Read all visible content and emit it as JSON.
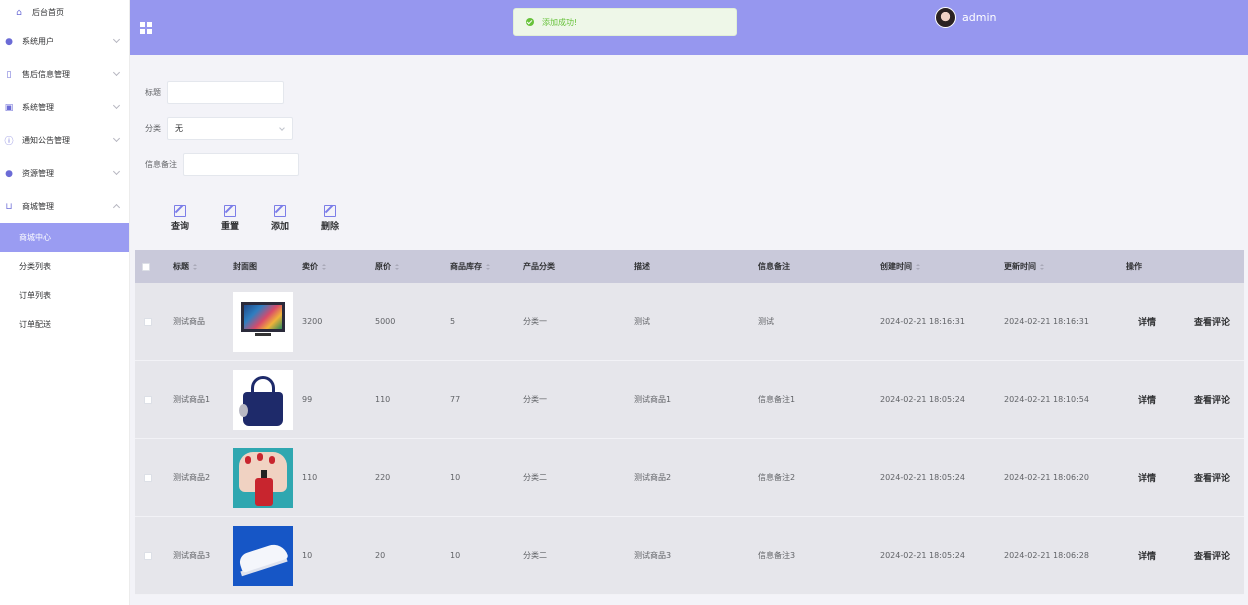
{
  "sidebar": {
    "home": "后台首页",
    "menus": [
      {
        "label": "系统用户",
        "icon": "user-icon"
      },
      {
        "label": "售后信息管理",
        "icon": "document-icon"
      },
      {
        "label": "系统管理",
        "icon": "image-icon"
      },
      {
        "label": "通知公告管理",
        "icon": "info-icon"
      },
      {
        "label": "资源管理",
        "icon": "pin-icon"
      },
      {
        "label": "商城管理",
        "icon": "cart-icon"
      }
    ],
    "sub_items": [
      "商城中心",
      "分类列表",
      "订单列表",
      "订单配送"
    ],
    "active_sub": "商城中心"
  },
  "header": {
    "toast": "添加成功!",
    "username": "admin"
  },
  "filters": {
    "title_label": "标题",
    "title_value": "",
    "category_label": "分类",
    "category_value": "无",
    "note_label": "信息备注",
    "note_value": ""
  },
  "actions": {
    "query": "查询",
    "reset": "重置",
    "add": "添加",
    "delete": "删除"
  },
  "table": {
    "headers": [
      "标题",
      "封面图",
      "卖价",
      "原价",
      "商品库存",
      "产品分类",
      "描述",
      "信息备注",
      "创建时间",
      "更新时间",
      "操作"
    ],
    "detail_label": "详情",
    "review_label": "查看评论",
    "rows": [
      {
        "title": "测试商品",
        "image": "tv-image",
        "price": "3200",
        "original": "5000",
        "stock": "5",
        "category": "分类一",
        "desc": "测试",
        "note": "测试",
        "created": "2024-02-21 18:16:31",
        "updated": "2024-02-21 18:16:31"
      },
      {
        "title": "测试商品1",
        "image": "handbag-image",
        "price": "99",
        "original": "110",
        "stock": "77",
        "category": "分类一",
        "desc": "测试商品1",
        "note": "信息备注1",
        "created": "2024-02-21 18:05:24",
        "updated": "2024-02-21 18:10:54"
      },
      {
        "title": "测试商品2",
        "image": "nail-polish-image",
        "price": "110",
        "original": "220",
        "stock": "10",
        "category": "分类二",
        "desc": "测试商品2",
        "note": "信息备注2",
        "created": "2024-02-21 18:05:24",
        "updated": "2024-02-21 18:06:20"
      },
      {
        "title": "测试商品3",
        "image": "sneaker-image",
        "price": "10",
        "original": "20",
        "stock": "10",
        "category": "分类二",
        "desc": "测试商品3",
        "note": "信息备注3",
        "created": "2024-02-21 18:05:24",
        "updated": "2024-02-21 18:06:28"
      }
    ]
  },
  "colors": {
    "header_bg": "#9697ef",
    "active_menu_bg": "#9a9cf2",
    "success": "#67c23a"
  }
}
